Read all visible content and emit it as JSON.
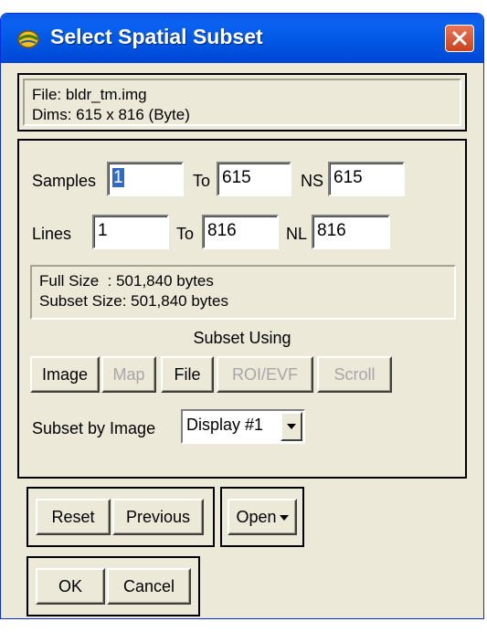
{
  "window": {
    "title": "Select Spatial Subset",
    "close_label": "Close"
  },
  "file_info": {
    "file_line": "File: bldr_tm.img",
    "dims_line": "Dims: 615 x 816 (Byte)"
  },
  "samples": {
    "label": "Samples",
    "from_value": "1",
    "to_label": "To",
    "to_value": "615",
    "ns_label": "NS",
    "ns_value": "615"
  },
  "lines": {
    "label": "Lines",
    "from_value": "1",
    "to_label": "To",
    "to_value": "816",
    "nl_label": "NL",
    "nl_value": "816"
  },
  "size_info": {
    "full_size": "Full Size  : 501,840 bytes",
    "subset_size": "Subset Size: 501,840 bytes"
  },
  "subset_using": {
    "heading": "Subset Using",
    "buttons": [
      {
        "label": "Image",
        "enabled": true
      },
      {
        "label": "Map",
        "enabled": false
      },
      {
        "label": "File",
        "enabled": true
      },
      {
        "label": "ROI/EVF",
        "enabled": false
      },
      {
        "label": "Scroll",
        "enabled": false
      }
    ]
  },
  "subset_by_image": {
    "label": "Subset by Image",
    "selected": "Display #1"
  },
  "actions": {
    "reset": "Reset",
    "previous": "Previous",
    "open": "Open",
    "ok": "OK",
    "cancel": "Cancel"
  },
  "colors": {
    "titlebar": "#0058e4",
    "dialog_bg": "#ece9d8",
    "close_button": "#d65a38",
    "selection": "#316ac5",
    "disabled_text": "#a7a6aa"
  }
}
